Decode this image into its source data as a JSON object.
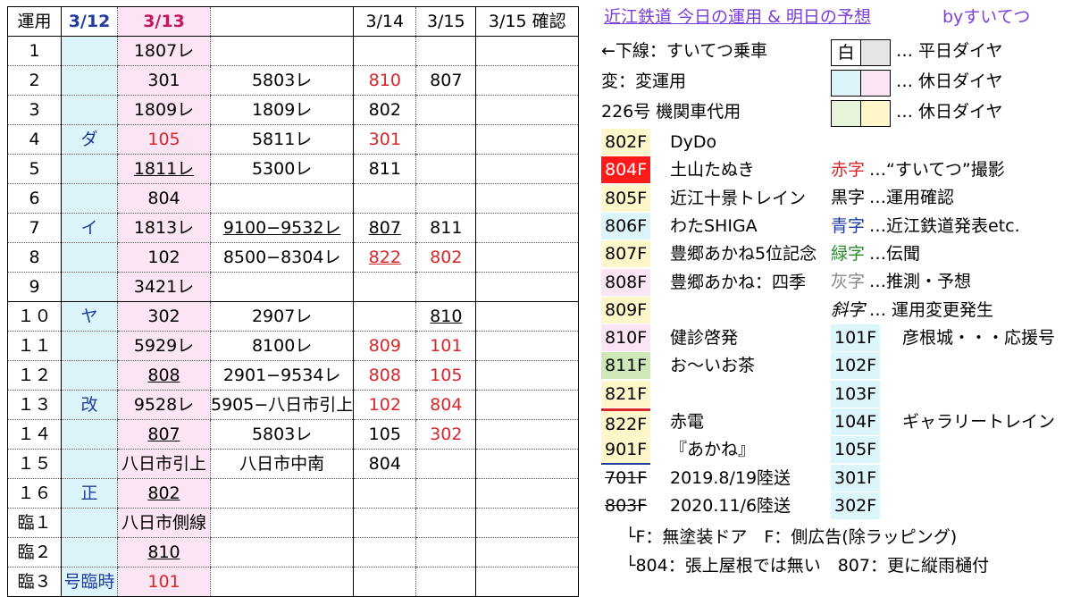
{
  "table": {
    "headers": [
      "運用",
      "3/12",
      "3/13",
      "",
      "3/14",
      "3/15",
      "3/15 確認"
    ],
    "rows": [
      {
        "op": "1",
        "d12": "",
        "d13": "1807レ",
        "mid": "",
        "d14": "",
        "d15": ""
      },
      {
        "op": "2",
        "d12": "",
        "d13": "301",
        "mid": "5803レ",
        "d14": "810",
        "d15": "807"
      },
      {
        "op": "3",
        "d12": "",
        "d13": "1809レ",
        "mid": "1809レ",
        "d14": "802",
        "d15": ""
      },
      {
        "op": "4",
        "d12": "ダ",
        "d13": "105",
        "mid": "5811レ",
        "d14": "301",
        "d15": ""
      },
      {
        "op": "5",
        "d12": "",
        "d13": "1811レ",
        "mid": "5300レ",
        "d14": "811",
        "d15": ""
      },
      {
        "op": "6",
        "d12": "",
        "d13": "804",
        "mid": "",
        "d14": "",
        "d15": ""
      },
      {
        "op": "7",
        "d12": "イ",
        "d13": "1813レ",
        "mid": "9100−9532レ",
        "d14": "807",
        "d15": "811"
      },
      {
        "op": "8",
        "d12": "",
        "d13": "102",
        "mid": "8500−8304レ",
        "d14": "822",
        "d15": "802"
      },
      {
        "op": "9",
        "d12": "",
        "d13": "3421レ",
        "mid": "",
        "d14": "",
        "d15": ""
      },
      {
        "op": "１０",
        "d12": "ヤ",
        "d13": "302",
        "mid": "2907レ",
        "d14": "",
        "d15": "810"
      },
      {
        "op": "１１",
        "d12": "",
        "d13": "5929レ",
        "mid": "8100レ",
        "d14": "809",
        "d15": "101"
      },
      {
        "op": "１２",
        "d12": "",
        "d13": "808",
        "mid": "2901−9534レ",
        "d14": "808",
        "d15": "105"
      },
      {
        "op": "１３",
        "d12": "改",
        "d13": "9528レ",
        "mid": "5905−八日市引上",
        "d14": "102",
        "d15": "804"
      },
      {
        "op": "１４",
        "d12": "",
        "d13": "807",
        "mid": "5803レ",
        "d14": "105",
        "d15": "302"
      },
      {
        "op": "１５",
        "d12": "",
        "d13": "八日市引上",
        "mid": "八日市中南",
        "d14": "804",
        "d15": ""
      },
      {
        "op": "１６",
        "d12": "正",
        "d13": "802",
        "mid": "",
        "d14": "",
        "d15": ""
      },
      {
        "op": "臨１",
        "d12": "",
        "d13": "八日市側線",
        "mid": "",
        "d14": "",
        "d15": ""
      },
      {
        "op": "臨２",
        "d12": "",
        "d13": "810",
        "mid": "",
        "d14": "",
        "d15": ""
      },
      {
        "op": "臨３",
        "d12": "号臨時",
        "d13": "101",
        "mid": "",
        "d14": "",
        "d15": ""
      }
    ]
  },
  "legend": {
    "title": "近江鉄道 今日の運用 & 明日の予想",
    "by": "byすいてつ",
    "line1": "←下線：すいてつ乗車",
    "line2": "変：変運用",
    "line3": "226号 機関車代用",
    "white_label": "白",
    "weekday": "… 平日ダイヤ",
    "holiday1": "… 休日ダイヤ",
    "holiday2": "… 休日ダイヤ",
    "cars": [
      {
        "code": "802F",
        "name": "DyDo"
      },
      {
        "code": "804F",
        "name": "土山たぬき"
      },
      {
        "code": "805F",
        "name": "近江十景トレイン"
      },
      {
        "code": "806F",
        "name": "わたSHIGA"
      },
      {
        "code": "807F",
        "name": "豊郷あかね5位記念"
      },
      {
        "code": "808F",
        "name": "豊郷あかね：四季"
      },
      {
        "code": "809F",
        "name": ""
      },
      {
        "code": "810F",
        "name": "健診啓発"
      },
      {
        "code": "811F",
        "name": "お〜いお茶"
      },
      {
        "code": "821F",
        "name": ""
      },
      {
        "code": "822F",
        "name": "赤電"
      },
      {
        "code": "901F",
        "name": "『あかね』"
      },
      {
        "code": "701F",
        "name": "2019.8/19陸送"
      },
      {
        "code": "803F",
        "name": "2020.11/6陸送"
      }
    ],
    "color_key": [
      {
        "k": "赤字",
        "v": "…“すいてつ”撮影"
      },
      {
        "k": "黒字",
        "v": "…運用確認"
      },
      {
        "k": "青字",
        "v": "…近江鉄道発表etc."
      },
      {
        "k": "緑字",
        "v": "…伝聞"
      },
      {
        "k": "灰字",
        "v": "…推測・予想"
      },
      {
        "k": "斜字",
        "v": "… 運用変更発生"
      }
    ],
    "cars2": [
      {
        "code": "101F",
        "name": "彦根城・・・応援号"
      },
      {
        "code": "102F",
        "name": ""
      },
      {
        "code": "103F",
        "name": ""
      },
      {
        "code": "104F",
        "name": "ギャラリートレイン"
      },
      {
        "code": "105F",
        "name": ""
      },
      {
        "code": "301F",
        "name": ""
      },
      {
        "code": "302F",
        "name": ""
      }
    ],
    "note1": "└F：無塗装ドア　F：側広告(除ラッピング)",
    "note2": "└804：張上屋根では無い　807：更に縦雨樋付"
  },
  "colors": {
    "pink": "#fbe4f3",
    "cyan": "#dcf5fa",
    "red": "#d8262b",
    "blue": "#1f3c9e",
    "title": "#7b3fd6"
  }
}
